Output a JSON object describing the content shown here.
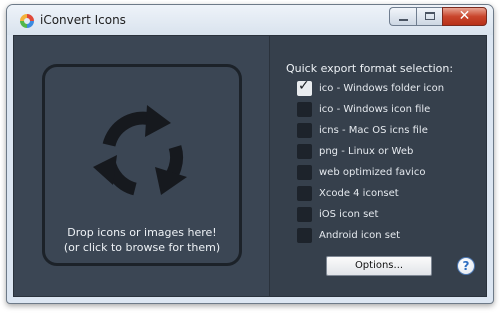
{
  "window": {
    "title": "iConvert Icons",
    "controls": {
      "minimize_icon": "minimize-icon",
      "maximize_icon": "maximize-icon",
      "close_glyph": "✕"
    }
  },
  "drop_zone": {
    "icon": "refresh-arrows-icon",
    "line1": "Drop icons or images here!",
    "line2": "(or click to browse for them)"
  },
  "export": {
    "title": "Quick export format selection:",
    "options": [
      {
        "label": "ico - Windows folder icon",
        "checked": true
      },
      {
        "label": "ico - Windows icon file",
        "checked": false
      },
      {
        "label": "icns - Mac OS icns file",
        "checked": false
      },
      {
        "label": "png - Linux or Web",
        "checked": false
      },
      {
        "label": "web optimized favico",
        "checked": false
      },
      {
        "label": "Xcode 4 iconset",
        "checked": false
      },
      {
        "label": "iOS icon set",
        "checked": false
      },
      {
        "label": "Android icon set",
        "checked": false
      }
    ],
    "check_glyph": "✓",
    "options_button": "Options...",
    "help_glyph": "?"
  },
  "colors": {
    "panel_bg": "#3a4452",
    "checkbox_bg": "#1d232b",
    "text": "#eef2f6"
  }
}
